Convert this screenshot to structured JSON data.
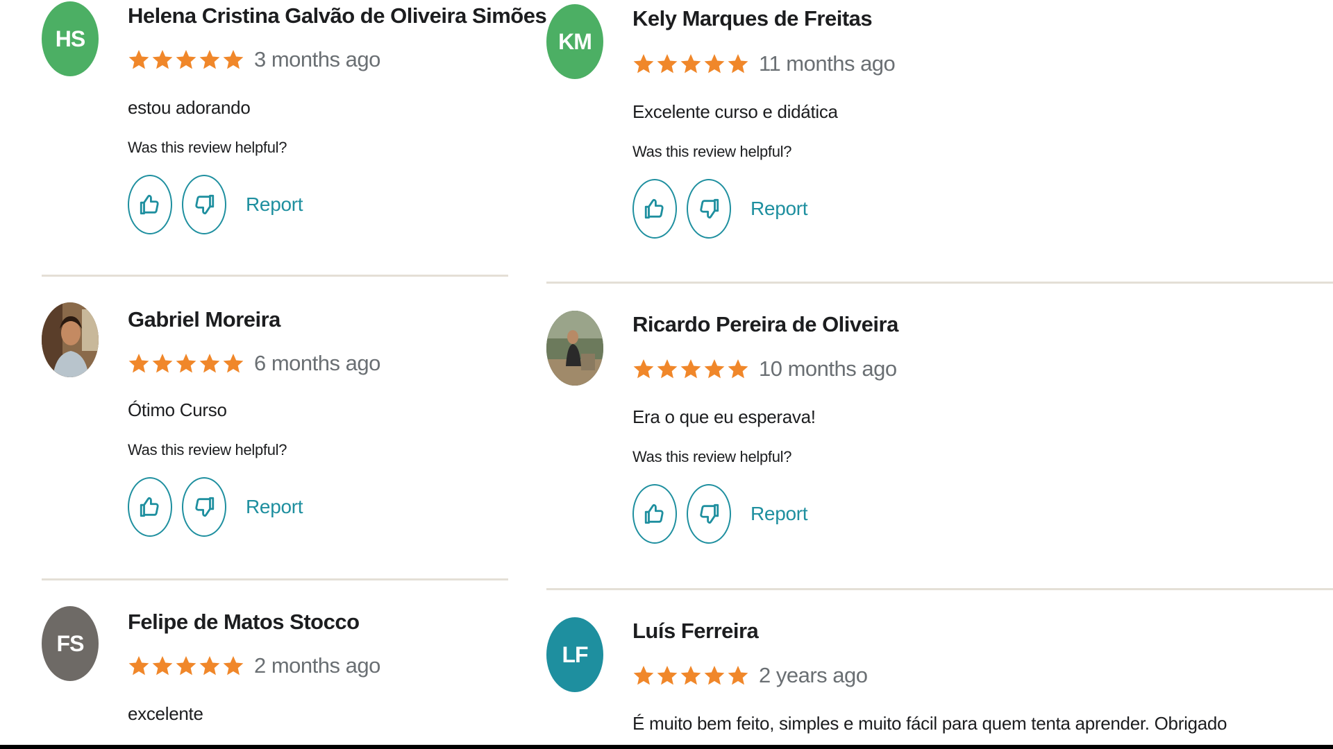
{
  "reviews_left": [
    {
      "initials": "HS",
      "avatar_color": "#4caf64",
      "name": "Helena Cristina Galvão de Oliveira Simões",
      "rating": 5,
      "time_ago": "3 months ago",
      "text": "estou adorando",
      "helpful_question": "Was this review helpful?",
      "report_label": "Report"
    },
    {
      "initials": "",
      "avatar_color": "#7a6a5a",
      "name": "Gabriel Moreira",
      "rating": 5,
      "time_ago": "6 months ago",
      "text": "Ótimo Curso",
      "helpful_question": "Was this review helpful?",
      "report_label": "Report"
    },
    {
      "initials": "FS",
      "avatar_color": "#6e6a66",
      "name": "Felipe de Matos Stocco",
      "rating": 5,
      "time_ago": "2 months ago",
      "text": "excelente"
    }
  ],
  "reviews_right": [
    {
      "initials": "KM",
      "avatar_color": "#4caf64",
      "name": "Kely Marques de Freitas",
      "rating": 5,
      "time_ago": "11 months ago",
      "text": "Excelente curso e didática",
      "helpful_question": "Was this review helpful?",
      "report_label": "Report"
    },
    {
      "initials": "",
      "avatar_color": "#5a6a50",
      "name": "Ricardo Pereira de Oliveira",
      "rating": 5,
      "time_ago": "10 months ago",
      "text": "Era o que eu esperava!",
      "helpful_question": "Was this review helpful?",
      "report_label": "Report"
    },
    {
      "initials": "LF",
      "avatar_color": "#1e8f9f",
      "name": "Luís Ferreira",
      "rating": 5,
      "time_ago": "2 years ago",
      "text": "É muito bem feito, simples e muito fácil para quem tenta aprender. Obrigado"
    }
  ],
  "icons": {
    "star": "star-icon",
    "thumbs_up": "thumbs-up-icon",
    "thumbs_down": "thumbs-down-icon"
  },
  "colors": {
    "star": "#f0872a",
    "accent": "#1e8f9f",
    "divider": "#e4dfd6"
  }
}
